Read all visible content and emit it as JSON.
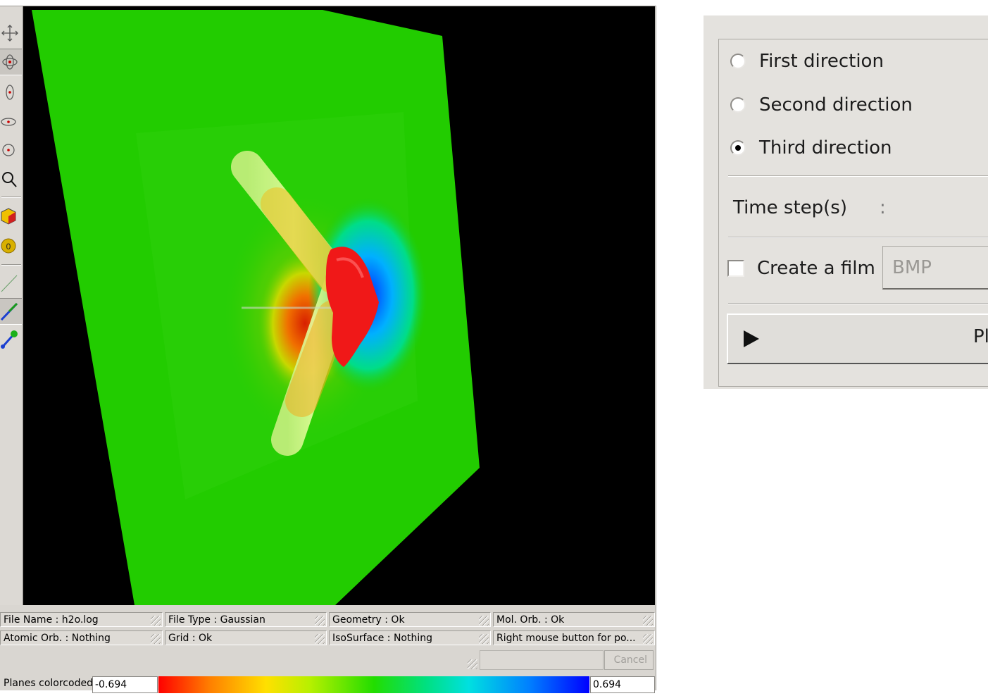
{
  "viewer": {
    "toolbar": [
      {
        "icon": "move-arrows-icon"
      },
      {
        "icon": "rotate-icon"
      },
      {
        "icon": "rotate-z-icon"
      },
      {
        "icon": "rotate-y-icon"
      },
      {
        "icon": "rotate-x-icon"
      },
      {
        "icon": "zoom-icon"
      },
      {
        "icon": "render-cube-icon"
      },
      {
        "icon": "atom-label-icon"
      },
      {
        "icon": "thin-line-icon"
      },
      {
        "icon": "bond-line-icon"
      },
      {
        "icon": "ball-stick-icon"
      }
    ],
    "status": {
      "file_name": "File Name : h2o.log",
      "file_type": "File Type : Gaussian",
      "geometry": "Geometry : Ok",
      "mol_orb": "Mol. Orb. : Ok",
      "atomic_orb": "Atomic Orb. : Nothing",
      "grid": "Grid : Ok",
      "isosurface": "IsoSurface : Nothing",
      "hint": "Right mouse button for po..."
    },
    "cancel_label": "Cancel",
    "colorbar": {
      "label": "Planes colorcoded",
      "min": "-0.694",
      "max": "0.694"
    },
    "colors": {
      "plane": "#22cc00",
      "isosurface": "#ff1010",
      "background": "#000000"
    }
  },
  "dialog": {
    "directions": [
      {
        "label": "First direction",
        "checked": false
      },
      {
        "label": "Second direction",
        "checked": false
      },
      {
        "label": "Third direction",
        "checked": true
      }
    ],
    "time_steps_label": "Time step(s)",
    "time_steps_separator": ":",
    "film_label": "Create a film",
    "film_checked": false,
    "format": "BMP",
    "play_label": "Pl"
  }
}
